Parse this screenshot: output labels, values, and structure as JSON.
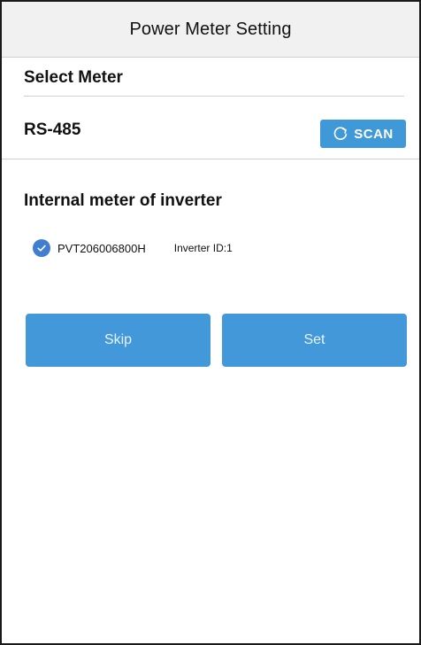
{
  "header": {
    "title": "Power Meter Setting"
  },
  "select_section": {
    "label": "Select Meter"
  },
  "rs485_row": {
    "label": "RS-485",
    "scan_button": {
      "label": "SCAN",
      "icon": "refresh-icon"
    }
  },
  "internal_meter": {
    "title": "Internal meter of inverter",
    "items": [
      {
        "checked": true,
        "serial": "PVT206006800H",
        "inverter_id": "Inverter ID:1"
      }
    ]
  },
  "actions": {
    "skip_label": "Skip",
    "set_label": "Set"
  },
  "colors": {
    "primary": "#4298d8",
    "check": "#3f7ed1",
    "header_bg": "#f1f1f1"
  }
}
